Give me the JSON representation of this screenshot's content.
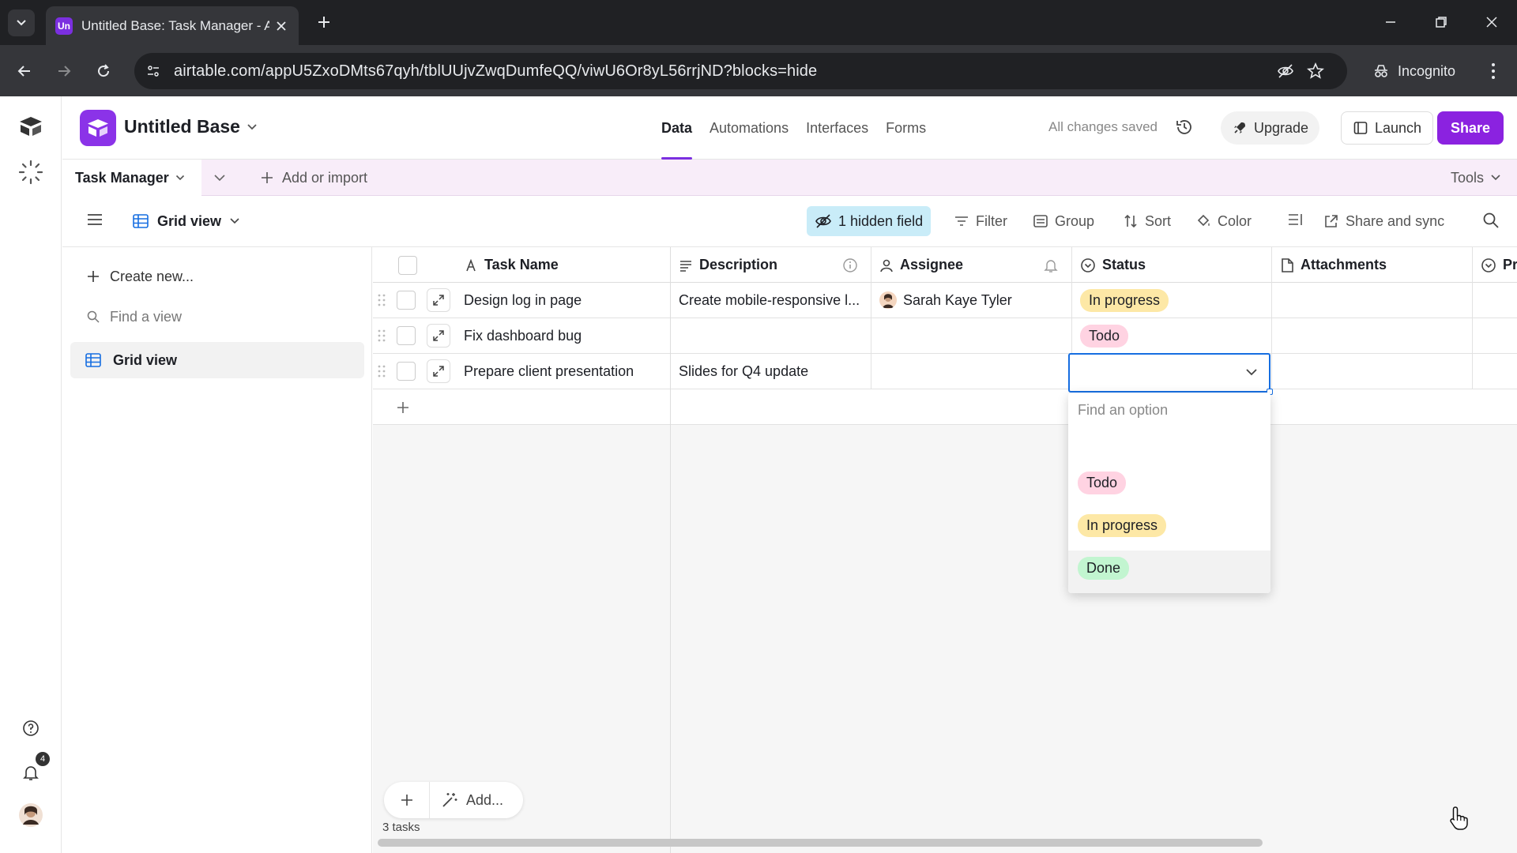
{
  "browser": {
    "tab_favicon": "Un",
    "tab_title": "Untitled Base: Task Manager - A",
    "url": "airtable.com/appU5ZxoDMts67qyh/tblUUjvZwqDumfeQQ/viwU6Or8yL56rrjND?blocks=hide",
    "incognito_label": "Incognito"
  },
  "app": {
    "base_name": "Untitled Base",
    "nav_tabs": [
      "Data",
      "Automations",
      "Interfaces",
      "Forms"
    ],
    "active_tab": "Data",
    "saved_status": "All changes saved",
    "upgrade_label": "Upgrade",
    "launch_label": "Launch",
    "share_label": "Share",
    "accent_color": "#8b22e0"
  },
  "table_bar": {
    "table_name": "Task Manager",
    "add_import_label": "Add or import",
    "tools_label": "Tools"
  },
  "view_bar": {
    "view_name": "Grid view",
    "hidden_fields_label": "1 hidden field",
    "filter_label": "Filter",
    "group_label": "Group",
    "sort_label": "Sort",
    "color_label": "Color",
    "share_sync_label": "Share and sync"
  },
  "sidebar": {
    "create_new_label": "Create new...",
    "find_view_placeholder": "Find a view",
    "views": [
      "Grid view"
    ]
  },
  "grid": {
    "columns": [
      "Task Name",
      "Description",
      "Assignee",
      "Status",
      "Attachments",
      "Pri"
    ],
    "rows": [
      {
        "task": "Design log in page",
        "description": "Create mobile-responsive l...",
        "assignee": "Sarah Kaye Tyler",
        "status": "In progress"
      },
      {
        "task": "Fix dashboard bug",
        "description": "",
        "assignee": "",
        "status": "Todo"
      },
      {
        "task": "Prepare client presentation",
        "description": "Slides for Q4 update",
        "assignee": "",
        "status": ""
      }
    ],
    "record_count": "3 tasks",
    "add_label": "Add..."
  },
  "status_dropdown": {
    "search_placeholder": "Find an option",
    "options": [
      "Todo",
      "In progress",
      "Done"
    ],
    "hovered_option": "Done"
  },
  "rail": {
    "notification_count": "4"
  }
}
